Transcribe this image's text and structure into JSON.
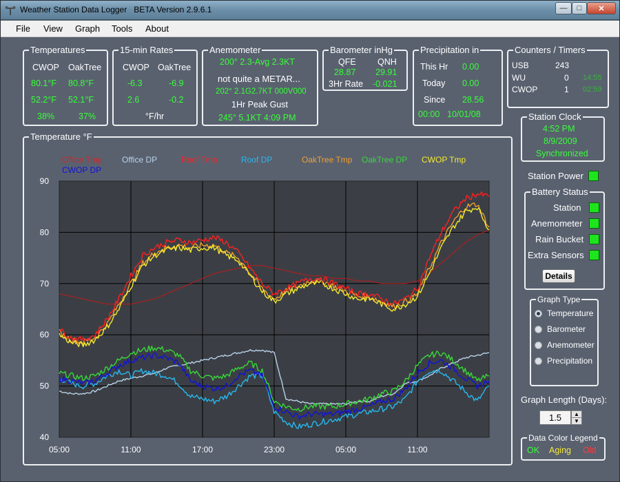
{
  "window": {
    "title": "Weather Station Data Logger   BETA Version 2.9.6.1",
    "icon": "anemometer-app-icon",
    "controls": [
      "minimize",
      "maximize",
      "close"
    ]
  },
  "menu": [
    "File",
    "View",
    "Graph",
    "Tools",
    "About"
  ],
  "temperatures": {
    "title": "Temperatures",
    "col1": "CWOP",
    "col2": "OakTree",
    "rows": [
      [
        "80.1°F",
        "80.8°F"
      ],
      [
        "52.2°F",
        "52.1°F"
      ],
      [
        "38%",
        "37%"
      ]
    ]
  },
  "rates": {
    "title": "15-min Rates",
    "col1": "CWOP",
    "col2": "OakTree",
    "rows": [
      [
        "-6.3",
        "-6.9"
      ],
      [
        "2.6",
        "-0.2"
      ]
    ],
    "unit": "°F/hr"
  },
  "anemometer": {
    "title": "Anemometer",
    "avg": "200° 2.3-Avg 2.3KT",
    "metar_label": "not quite a METAR...",
    "metar": "202° 2.1G2.7KT 000V000",
    "gust_label": "1Hr Peak Gust",
    "gust": "245° 5.1KT  4:09 PM"
  },
  "barometer": {
    "title": "Barometer  inHg",
    "qfe_label": "QFE",
    "qnh_label": "QNH",
    "qfe": "28.87",
    "qnh": "29.91",
    "rate_label": "3Hr Rate",
    "rate": "-0.021"
  },
  "precip": {
    "title": "Precipitation   in",
    "this_hr_label": "This Hr",
    "this_hr": "0.00",
    "today_label": "Today",
    "today": "0.00",
    "since_label": "Since",
    "since": "28.56",
    "since_time": "00:00",
    "since_date": "10/01/08"
  },
  "counters": {
    "title": "Counters / Timers",
    "rows": [
      {
        "name": "USB",
        "count": "243",
        "timer": ""
      },
      {
        "name": "WU",
        "count": "0",
        "timer": "14:55"
      },
      {
        "name": "CWOP",
        "count": "1",
        "timer": "02:59"
      }
    ]
  },
  "clock": {
    "title": "Station Clock",
    "time": "4:52 PM",
    "date": "8/9/2009",
    "status": "Synchronized"
  },
  "power": {
    "label": "Station Power"
  },
  "battery": {
    "title": "Battery Status",
    "items": [
      "Station",
      "Anemometer",
      "Rain Bucket",
      "Extra Sensors"
    ],
    "details_button": "Details"
  },
  "graph_type": {
    "title": "Graph Type",
    "options": [
      "Temperature",
      "Barometer",
      "Anemometer",
      "Precipitation"
    ],
    "selected": "Temperature"
  },
  "graph_length": {
    "label": "Graph Length (Days):",
    "value": "1.5"
  },
  "color_legend": {
    "title": "Data Color Legend",
    "ok": "OK",
    "aging": "Aging",
    "old": "Old",
    "colors": {
      "ok": "#38ff38",
      "aging": "#f5e63a",
      "old": "#ff3a3a"
    }
  },
  "chart_title": "Temperature  °F",
  "chart_data": {
    "type": "line",
    "ylim": [
      40,
      90
    ],
    "ytick_labels": [
      "90",
      "80",
      "70",
      "60",
      "50",
      "40"
    ],
    "xtick_labels": [
      "05:00",
      "11:00",
      "17:00",
      "23:00",
      "05:00",
      "11:00"
    ],
    "grid": true,
    "legend_position": "top",
    "x_hours": [
      0,
      1,
      2,
      3,
      4,
      5,
      6,
      7,
      8,
      9,
      10,
      11,
      12,
      13,
      14,
      15,
      16,
      17,
      18,
      19,
      20,
      21,
      22,
      23,
      24,
      25,
      26,
      27,
      28,
      29,
      30,
      31,
      32,
      33,
      34,
      35,
      36
    ],
    "series": [
      {
        "name": "Office Tmp",
        "color": "#cc2a2a",
        "values": [
          null,
          null,
          null,
          null,
          null,
          null,
          null,
          null,
          null,
          null,
          null,
          null,
          null,
          null,
          null,
          null,
          null,
          null,
          null,
          null,
          null,
          null,
          null,
          null,
          null,
          null,
          null,
          null,
          null,
          null,
          null,
          null,
          null,
          null,
          null,
          null,
          null
        ]
      },
      {
        "name": "Office DP",
        "color": "#b9d2ea",
        "values": [
          49,
          48.5,
          48.5,
          49,
          50,
          51,
          51.5,
          52,
          52.5,
          53.5,
          54,
          54.5,
          55,
          55.5,
          56,
          56.5,
          57,
          57,
          56.5,
          47.5,
          47,
          46.5,
          46.5,
          46.5,
          46.5,
          47,
          47,
          48,
          48.5,
          50.5,
          51,
          52,
          53.5,
          54.5,
          55.5,
          56,
          56.5
        ]
      },
      {
        "name": "Roof Tmp",
        "color": "#ff2020",
        "values": [
          61,
          59.5,
          59,
          60,
          63,
          67,
          71.5,
          75.5,
          77,
          78,
          78.5,
          78,
          78.5,
          79,
          78,
          76,
          73,
          70,
          68,
          69,
          70,
          71,
          71,
          70,
          69,
          68,
          68,
          67,
          66,
          67,
          69,
          75,
          80,
          84,
          86.5,
          87.5,
          87
        ]
      },
      {
        "name": "Roof DP",
        "color": "#27b8f0",
        "values": [
          51.5,
          50.5,
          50,
          50.5,
          52,
          53,
          52,
          53,
          52.5,
          52,
          50.5,
          48,
          47.5,
          47,
          48,
          50,
          52,
          52,
          45,
          43,
          42,
          42.5,
          43,
          43.5,
          44,
          44.5,
          45,
          45.5,
          46,
          47.5,
          51,
          53,
          53,
          51,
          49,
          47,
          50
        ]
      },
      {
        "name": "OakTree Tmp",
        "color": "#f0a030",
        "values": [
          60.5,
          59,
          58.5,
          59.5,
          62,
          66,
          70,
          74,
          76,
          77,
          77.5,
          77,
          77.5,
          77.5,
          76,
          75,
          72,
          69,
          67,
          68.5,
          69.5,
          70.5,
          70.5,
          69.5,
          68.5,
          67.5,
          67.5,
          66.5,
          65.5,
          66.5,
          68,
          73,
          78,
          82,
          85,
          85.5,
          81
        ]
      },
      {
        "name": "OakTree DP",
        "color": "#38d838",
        "values": [
          52.5,
          52,
          51.5,
          52,
          53.5,
          55,
          56.5,
          57,
          57.5,
          57,
          56,
          53,
          52,
          51.5,
          52,
          53.5,
          54.5,
          53,
          47,
          46,
          45.5,
          46,
          46,
          46,
          46.5,
          47,
          47.5,
          48.5,
          49,
          51,
          54,
          56,
          56.5,
          55,
          53,
          51,
          52
        ]
      },
      {
        "name": "CWOP Tmp",
        "color": "#f5ea2e",
        "values": [
          60,
          58.5,
          58,
          59,
          61.5,
          65,
          69.5,
          73.5,
          75.5,
          76.5,
          77,
          76.5,
          77,
          77,
          75.5,
          74.5,
          71.5,
          68.5,
          66.5,
          68,
          69,
          70,
          70,
          69,
          68,
          67,
          67,
          66,
          65,
          66,
          67.5,
          72,
          77,
          81,
          84,
          85,
          80.5
        ]
      },
      {
        "name": "CWOP DP",
        "color": "#1212d8",
        "values": [
          51.5,
          51,
          50.5,
          51,
          52.5,
          54,
          55,
          55.5,
          56,
          55.5,
          54.5,
          51,
          50,
          49.5,
          50,
          52,
          53,
          52,
          46,
          45,
          44,
          44.5,
          44.5,
          44.5,
          45,
          45.5,
          46,
          47,
          47.5,
          49.5,
          52.5,
          54.5,
          55,
          53.5,
          51.5,
          50,
          51
        ]
      },
      {
        "name": "",
        "color": "#c01818",
        "values": [
          68,
          67.5,
          67,
          66.5,
          66,
          66,
          66,
          66.5,
          67,
          68,
          69,
          70,
          71,
          72,
          72.5,
          73,
          73.5,
          73.5,
          73,
          72.5,
          72,
          71.5,
          71.5,
          71,
          71,
          70.5,
          70.5,
          70,
          70,
          70,
          70.5,
          72,
          74,
          76,
          78,
          79.5,
          80.5
        ]
      }
    ]
  }
}
